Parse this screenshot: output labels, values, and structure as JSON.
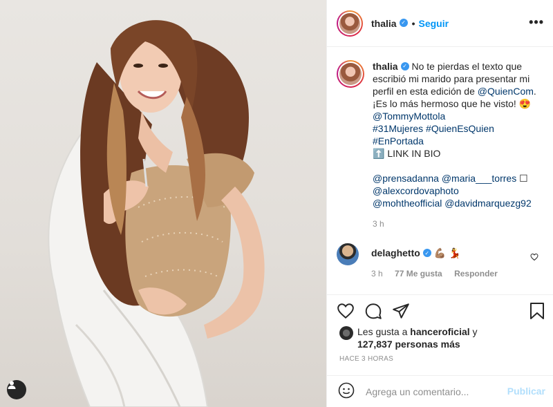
{
  "post": {
    "username": "thalia",
    "verified": true,
    "follow_label": "Seguir",
    "separator": "•",
    "more_icon": "more-horizontal-icon"
  },
  "caption": {
    "username": "thalia",
    "text_line1": "No te pierdas el texto que escribió mi marido para presentar mi perfil en esta edición de ",
    "mention_quiencom": "@QuienCom",
    "text_after_mention": ".",
    "text_line2": "¡Es lo más hermoso que he visto! 😍",
    "mention_tommy": "@TommyMottola",
    "hashtags_1": "#31Mujeres",
    "hashtags_2": "#QuienEsQuien",
    "hashtags_3": "#EnPortada",
    "link_in_bio": "⬆️ LINK IN BIO",
    "credit_1": "@prensadanna",
    "credit_2": "@maria___torres",
    "credit_box": "☐",
    "credit_3": "@alexcordovaphoto",
    "credit_4": "@mohtheofficial",
    "credit_5": "@davidmarquezg92",
    "time": "3 h"
  },
  "reply": {
    "username": "delaghetto",
    "text": "💪🏽 💃",
    "time": "3 h",
    "likes": "77 Me gusta",
    "reply_label": "Responder"
  },
  "likes": {
    "prefix": "Les gusta a ",
    "user": "hanceroficial",
    "connector": " y",
    "count": "127,837 personas más"
  },
  "timestamp": "HACE 3 HORAS",
  "comment_box": {
    "placeholder": "Agrega un comentario...",
    "publish_label": "Publicar"
  },
  "colors": {
    "accent": "#0095f6",
    "link": "#00376b",
    "muted": "#8e8e8e",
    "publish_disabled": "#b2dffc"
  }
}
